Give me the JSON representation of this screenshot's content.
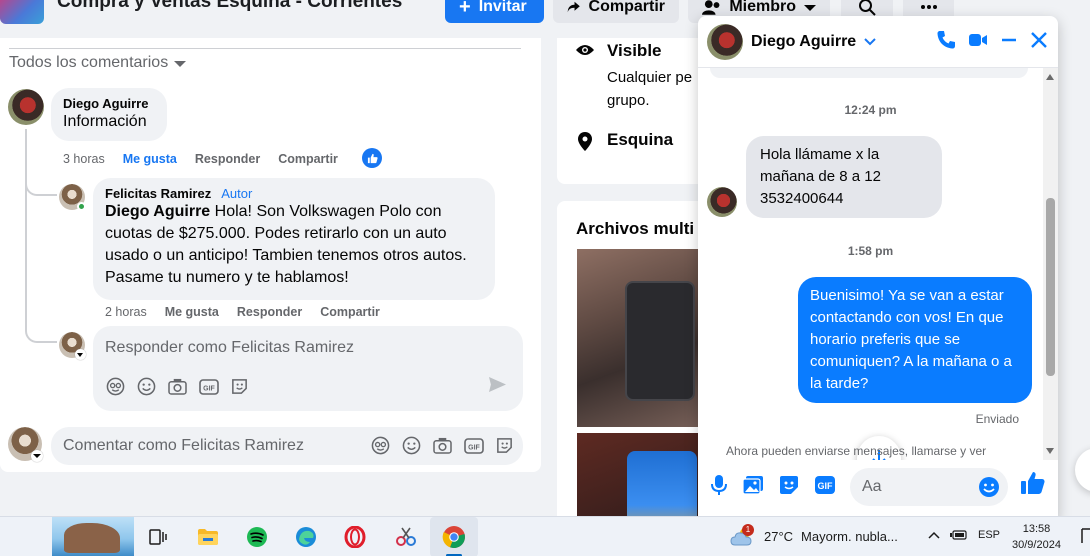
{
  "group": {
    "title": "Compra y Ventas Esquina - Corrientes",
    "invite_label": "Invitar",
    "share_label": "Compartir",
    "member_label": "Miembro"
  },
  "comments": {
    "sort_label": "Todos los comentarios",
    "items": [
      {
        "author": "Diego Aguirre",
        "text": "Información",
        "time": "3 horas",
        "like": "Me gusta",
        "reply": "Responder",
        "share": "Compartir"
      },
      {
        "author": "Felicitas Ramirez",
        "badge": "Autor",
        "mention": "Diego Aguirre",
        "text": " Hola! Son Volkswagen Polo con cuotas de $275.000. Podes retirarlo con un auto usado o un anticipo! Tambien tenemos otros autos. Pasame tu numero y te hablamos!",
        "time": "2 horas",
        "like": "Me gusta",
        "reply": "Responder",
        "share": "Compartir"
      }
    ],
    "reply_placeholder": "Responder como Felicitas Ramirez",
    "comment_placeholder": "Comentar como Felicitas Ramirez"
  },
  "about": {
    "visible_title": "Visible",
    "visible_desc": "Cualquier pe grupo.",
    "location_title": "Esquina"
  },
  "media": {
    "title": "Archivos multi"
  },
  "chat": {
    "contact": "Diego Aguirre",
    "messages": [
      {
        "type": "time",
        "text": "12:24 pm"
      },
      {
        "type": "in",
        "text": "Hola llámame x la mañana de 8 a 12 3532400644"
      },
      {
        "type": "time",
        "text": "1:58 pm"
      },
      {
        "type": "out",
        "text": "Buenisimo! Ya se van a estar contactando con vos! En que horario preferis que se comuniquen? A la mañana o a la tarde?"
      }
    ],
    "sent_label": "Enviado",
    "notice": "Ahora pueden enviarse mensajes, llamarse y ver",
    "input_placeholder": "Aa"
  },
  "taskbar": {
    "weather_temp": "27°C",
    "weather_desc": "Mayorm. nubla...",
    "notification_count": "1",
    "language": "ESP",
    "time": "13:58",
    "date": "30/9/2024"
  },
  "colors": {
    "accent": "#1877f2",
    "chat_out": "#0a7cff",
    "bubble": "#f0f2f5"
  }
}
